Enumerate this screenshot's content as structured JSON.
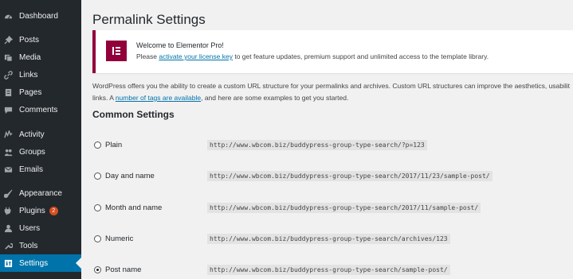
{
  "sidebar": {
    "items": [
      {
        "label": "Dashboard",
        "icon": "dashboard-icon"
      },
      {
        "label": "Posts",
        "icon": "pin-icon"
      },
      {
        "label": "Media",
        "icon": "media-icon"
      },
      {
        "label": "Links",
        "icon": "link-icon"
      },
      {
        "label": "Pages",
        "icon": "page-icon"
      },
      {
        "label": "Comments",
        "icon": "comment-icon"
      },
      {
        "label": "Activity",
        "icon": "activity-icon"
      },
      {
        "label": "Groups",
        "icon": "groups-icon"
      },
      {
        "label": "Emails",
        "icon": "email-icon"
      },
      {
        "label": "Appearance",
        "icon": "brush-icon"
      },
      {
        "label": "Plugins",
        "icon": "plugin-icon",
        "badge": "2"
      },
      {
        "label": "Users",
        "icon": "user-icon"
      },
      {
        "label": "Tools",
        "icon": "wrench-icon"
      },
      {
        "label": "Settings",
        "icon": "settings-icon",
        "active": true
      }
    ]
  },
  "page": {
    "title": "Permalink Settings"
  },
  "notice": {
    "title": "Welcome to Elementor Pro!",
    "text_before": "Please ",
    "link": "activate your license key",
    "text_after": " to get feature updates, premium support and unlimited access to the template library.",
    "logo_letter": "E"
  },
  "intro": {
    "line1": "WordPress offers you the ability to create a custom URL structure for your permalinks and archives. Custom URL structures can improve the aesthetics, usabilit",
    "line2_before": "links. A ",
    "line2_link": "number of tags are available",
    "line2_after": ", and here are some examples to get you started."
  },
  "common": {
    "title": "Common Settings",
    "options": [
      {
        "label": "Plain",
        "code": "http://www.wbcom.biz/buddypress-group-type-search/?p=123",
        "checked": false
      },
      {
        "label": "Day and name",
        "code": "http://www.wbcom.biz/buddypress-group-type-search/2017/11/23/sample-post/",
        "checked": false
      },
      {
        "label": "Month and name",
        "code": "http://www.wbcom.biz/buddypress-group-type-search/2017/11/sample-post/",
        "checked": false
      },
      {
        "label": "Numeric",
        "code": "http://www.wbcom.biz/buddypress-group-type-search/archives/123",
        "checked": false
      },
      {
        "label": "Post name",
        "code": "http://www.wbcom.biz/buddypress-group-type-search/sample-post/",
        "checked": true
      }
    ]
  },
  "colors": {
    "sidebar_bg": "#23282d",
    "active_bg": "#0073aa",
    "elementor": "#92003b",
    "link": "#0073aa"
  }
}
